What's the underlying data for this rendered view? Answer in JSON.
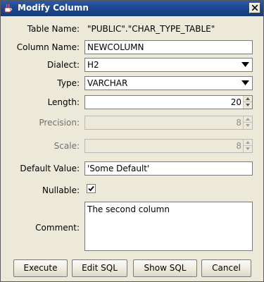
{
  "window": {
    "title": "Modify Column",
    "icon": "java-cup-icon"
  },
  "form": {
    "table_name": {
      "label": "Table Name:",
      "value": "\"PUBLIC\".\"CHAR_TYPE_TABLE\""
    },
    "column_name": {
      "label": "Column Name:",
      "value": "NEWCOLUMN"
    },
    "dialect": {
      "label": "Dialect:",
      "value": "H2"
    },
    "type": {
      "label": "Type:",
      "value": "VARCHAR"
    },
    "length": {
      "label": "Length:",
      "value": "20"
    },
    "precision": {
      "label": "Precision:",
      "value": "8"
    },
    "scale": {
      "label": "Scale:",
      "value": "8"
    },
    "default_value": {
      "label": "Default Value:",
      "value": "'Some Default'"
    },
    "nullable": {
      "label": "Nullable:",
      "checked": true
    },
    "comment": {
      "label": "Comment:",
      "value": "The second column"
    }
  },
  "buttons": {
    "execute": "Execute",
    "edit_sql": "Edit SQL",
    "show_sql": "Show SQL",
    "cancel": "Cancel"
  },
  "colors": {
    "titlebar": "#1e4690",
    "dialog_bg": "#ece9d8"
  }
}
